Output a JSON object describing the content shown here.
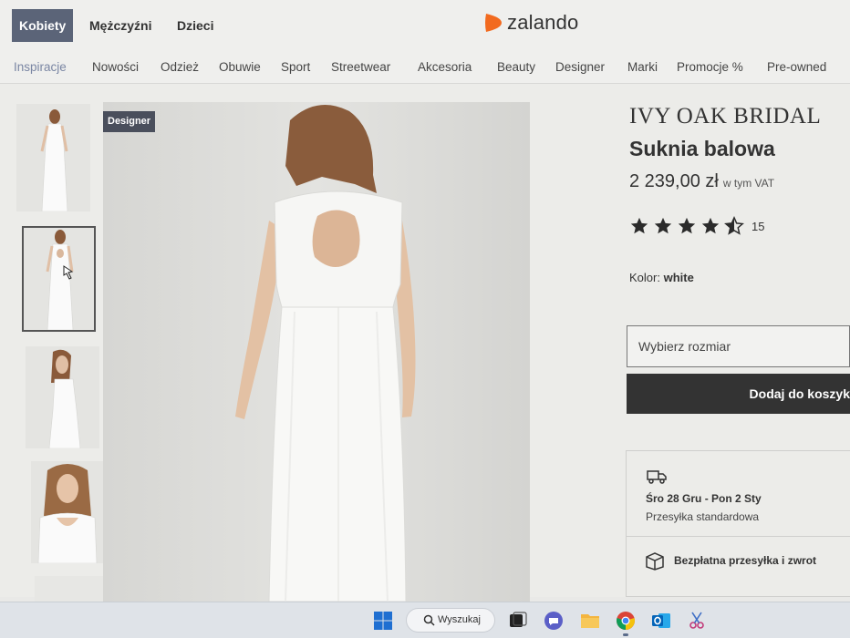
{
  "header": {
    "gender_tabs": [
      "Kobiety",
      "Mężczyźni",
      "Dzieci"
    ],
    "logo_text": "zalando",
    "brand_color": "#f26a1f"
  },
  "categories": [
    "Inspiracje",
    "Nowości",
    "Odzież",
    "Obuwie",
    "Sport",
    "Streetwear",
    "Akcesoria",
    "Beauty",
    "Designer",
    "Marki",
    "Promocje %",
    "Pre-owned"
  ],
  "gallery": {
    "badge": "Designer",
    "thumbnails": [
      "front-view",
      "back-view",
      "side-view",
      "detail-view",
      "lower-view"
    ],
    "selected_index": 1
  },
  "product": {
    "brand": "IVY OAK BRIDAL",
    "name": "Suknia balowa",
    "price": "2 239,00 zł",
    "vat_note": "w tym VAT",
    "rating": 4.5,
    "rating_count": "15",
    "color_label": "Kolor:",
    "color_value": "white",
    "size_placeholder": "Wybierz rozmiar",
    "add_to_cart": "Dodaj do koszyk"
  },
  "delivery": {
    "date_range": "Śro 28 Gru - Pon 2 Sty",
    "shipping_type": "Przesyłka standardowa",
    "free_shipping": "Bezpłatna przesyłka i zwrot"
  },
  "taskbar": {
    "search_label": "Wyszukaj",
    "icons": [
      "windows-start-icon",
      "search-icon",
      "task-view-icon",
      "teams-chat-icon",
      "file-explorer-icon",
      "chrome-icon",
      "outlook-icon",
      "snipping-tool-icon"
    ]
  }
}
